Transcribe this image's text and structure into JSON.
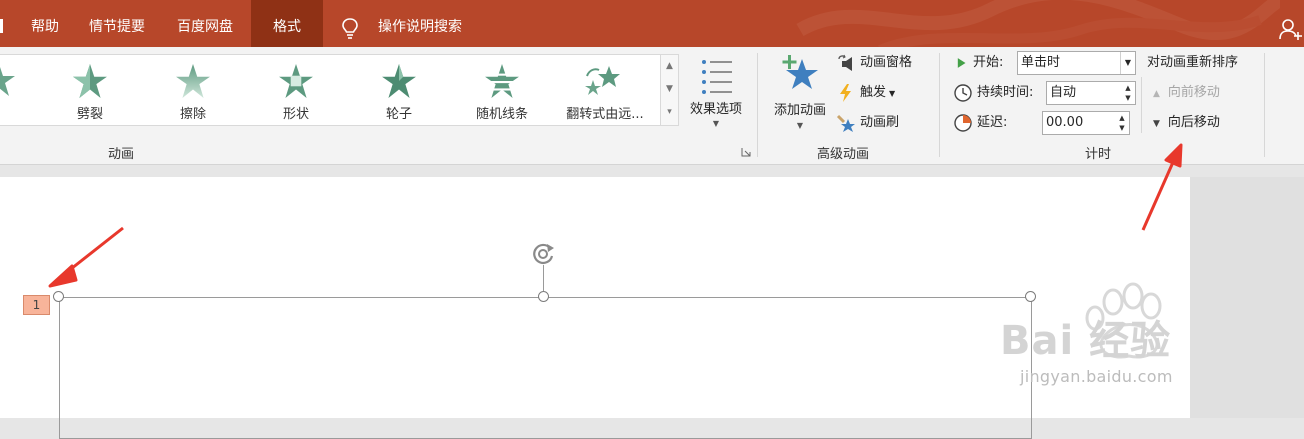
{
  "tabs": [
    {
      "label": "帮助",
      "active": false
    },
    {
      "label": "情节提要",
      "active": false
    },
    {
      "label": "百度网盘",
      "active": false
    },
    {
      "label": "格式",
      "active": true
    }
  ],
  "tell_me": "操作说明搜索",
  "gallery": [
    "劈裂",
    "擦除",
    "形状",
    "轮子",
    "随机线条",
    "翻转式由远..."
  ],
  "group_animation": "动画",
  "effect_options": "效果选项",
  "advanced": {
    "add_animation": "添加动画",
    "animation_pane": "动画窗格",
    "trigger": "触发",
    "animation_painter": "动画刷",
    "group_label": "高级动画"
  },
  "timing": {
    "start_label": "开始:",
    "start_value": "单击时",
    "duration_label": "持续时间:",
    "duration_value": "自动",
    "delay_label": "延迟:",
    "delay_value": "00.00",
    "reorder_title": "对动画重新排序",
    "move_earlier": "向前移动",
    "move_later": "向后移动",
    "group_label": "计时"
  },
  "slide": {
    "animation_number": "1"
  },
  "watermark": {
    "logo": "Bai 经验",
    "url": "jingyan.baidu.com"
  },
  "colors": {
    "tabbar": "#b7472a",
    "active_tab": "#8f3115",
    "star_green": "#5d9a80",
    "add_star": "#3f7fbf",
    "arrow_red": "#e8382c"
  }
}
